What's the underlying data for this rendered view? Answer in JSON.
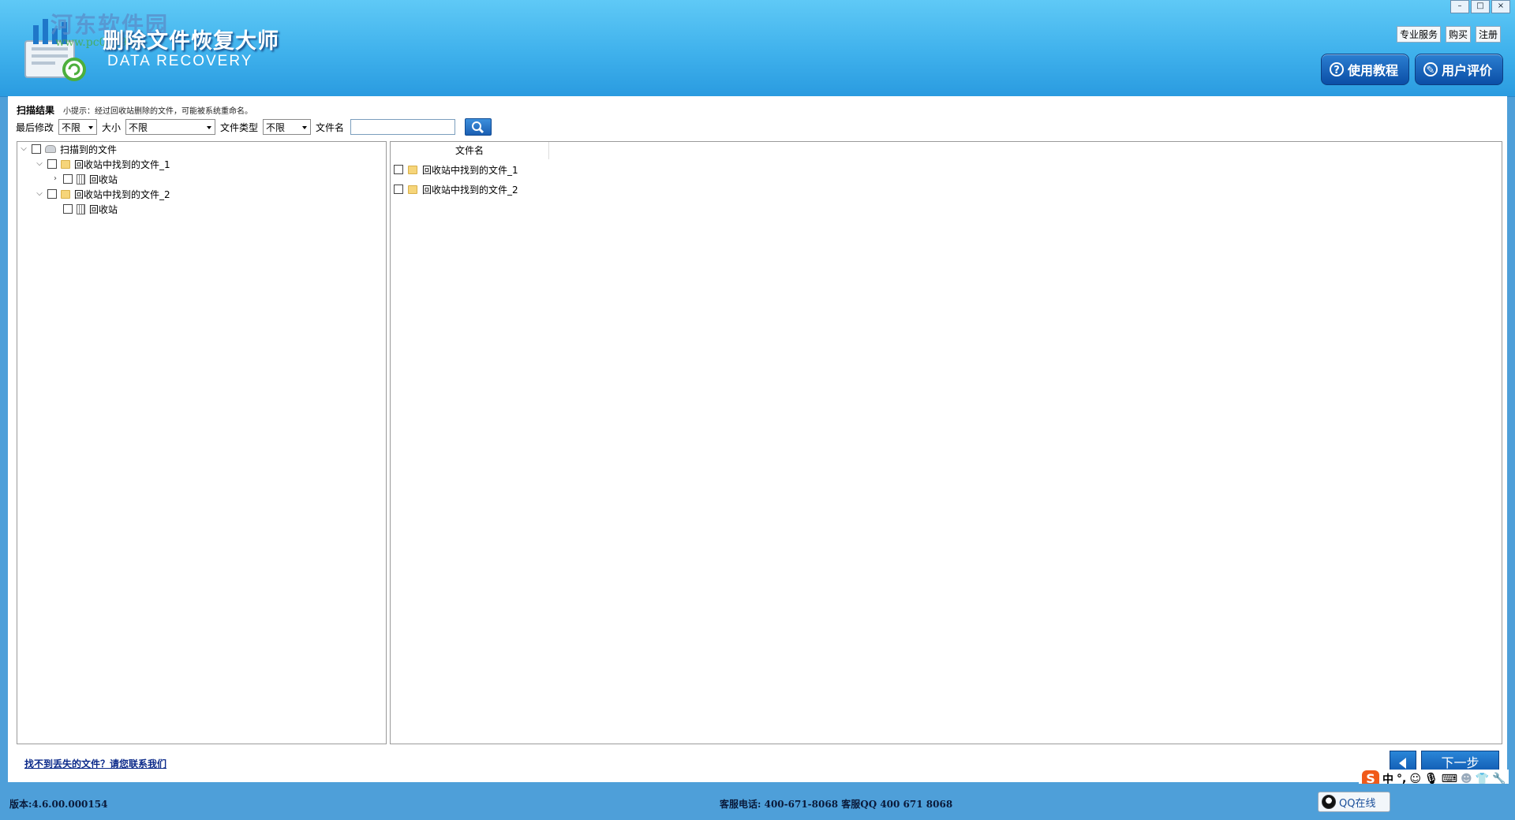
{
  "app": {
    "title": "删除文件恢复大师",
    "subtitle": "DATA RECOVERY",
    "watermark": "河东软件园",
    "watermark_url": "www.pc0359.cn"
  },
  "window_controls": {
    "minimize": "–",
    "maximize": "□",
    "close": "×"
  },
  "top_links": [
    "专业服务",
    "购买",
    "注册"
  ],
  "header_buttons": {
    "tutorial": "使用教程",
    "review": "用户评价"
  },
  "scan": {
    "title": "扫描结果",
    "hint": "小提示：经过回收站删除的文件，可能被系统重命名。"
  },
  "filters": {
    "last_modified_label": "最后修改",
    "last_modified_value": "不限",
    "size_label": "大小",
    "size_value": "不限",
    "file_type_label": "文件类型",
    "file_type_value": "不限",
    "file_name_label": "文件名",
    "file_name_value": ""
  },
  "tree": {
    "root": "扫描到的文件",
    "items": [
      {
        "label": "回收站中找到的文件_1",
        "children": [
          "回收站"
        ]
      },
      {
        "label": "回收站中找到的文件_2",
        "children": [
          "回收站"
        ]
      }
    ]
  },
  "file_list": {
    "column_header": "文件名",
    "rows": [
      "回收站中找到的文件_1",
      "回收站中找到的文件_2"
    ]
  },
  "footer": {
    "contact_link": "找不到丢失的文件？请您联系我们",
    "next_label": "下一步"
  },
  "ime": {
    "mode": "中",
    "punct": "°,",
    "icons": [
      "smile-icon",
      "mic-icon",
      "keyboard-icon",
      "user-icon",
      "shirt-icon",
      "wrench-icon"
    ]
  },
  "status": {
    "version": "版本:4.6.00.000154",
    "service": "客服电话: 400-671-8068 客服QQ 400 671 8068",
    "qq_online": "QQ在线"
  },
  "colors": {
    "header_top": "#5fc9f6",
    "header_bottom": "#2a9be0",
    "button_blue": "#0d55ad",
    "status_bar": "#4e9fd9"
  }
}
